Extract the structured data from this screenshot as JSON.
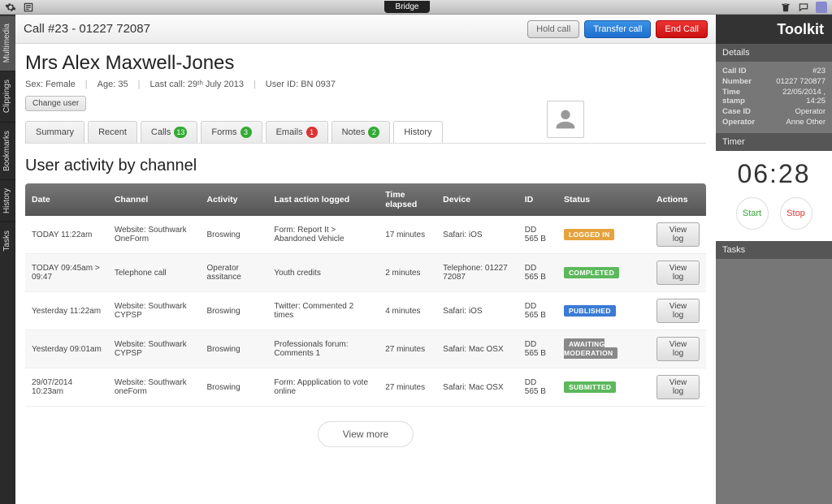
{
  "osbar": {
    "center_label": "Bridge"
  },
  "callbar": {
    "title": "Call #23 - 01227 72087",
    "hold": "Hold call",
    "transfer": "Transfer call",
    "end": "End Call"
  },
  "user": {
    "name": "Mrs Alex Maxwell-Jones",
    "sex_label": "Sex:",
    "sex": "Female",
    "age_label": "Age:",
    "age": "35",
    "last_call_label": "Last call:",
    "last_call": "29ᵗʰ July  2013",
    "user_id_label": "User ID:",
    "user_id": "BN 0937",
    "change": "Change user"
  },
  "tabs": {
    "summary": "Summary",
    "recent": "Recent",
    "calls": "Calls",
    "calls_badge": "13",
    "forms": "Forms",
    "forms_badge": "3",
    "emails": "Emails",
    "emails_badge": "1",
    "notes": "Notes",
    "notes_badge": "2",
    "history": "History"
  },
  "section_title": "User activity by channel",
  "headers": {
    "date": "Date",
    "channel": "Channel",
    "activity": "Activity",
    "last": "Last action logged",
    "elapsed": "Time elapsed",
    "device": "Device",
    "id": "ID",
    "status": "Status",
    "actions": "Actions"
  },
  "view_log": "View log",
  "view_more": "View more",
  "rows": [
    {
      "date": "TODAY 11:22am",
      "channel": "Website: Southwark OneForm",
      "activity": "Broswing",
      "last": "Form: Report It > Abandoned Vehicle",
      "elapsed": "17 minutes",
      "device": "Safari: iOS",
      "id": "DD 565 B",
      "status": "LOGGED IN",
      "st": "st-logged"
    },
    {
      "date": "TODAY 09:45am > 09:47",
      "channel": "Telephone call",
      "activity": "Operator assitance",
      "last": "Youth credits",
      "elapsed": "2 minutes",
      "device": "Telephone: 01227 72087",
      "id": "DD 565 B",
      "status": "COMPLETED",
      "st": "st-completed"
    },
    {
      "date": "Yesterday 11:22am",
      "channel": "Website: Southwark CYPSP",
      "activity": "Broswing",
      "last": "Twitter: Commented 2 times",
      "elapsed": "4 minutes",
      "device": "Safari: iOS",
      "id": "DD 565 B",
      "status": "PUBLISHED",
      "st": "st-published"
    },
    {
      "date": "Yesterday 09:01am",
      "channel": "Website: Southwark CYPSP",
      "activity": "Broswing",
      "last": "Professionals forum: Comments 1",
      "elapsed": "27 minutes",
      "device": "Safari: Mac OSX",
      "id": "DD 565 B",
      "status": "AWAITING MODERATION",
      "st": "st-moderation"
    },
    {
      "date": "29/07/2014 10:23am",
      "channel": "Website: Southwark oneForm",
      "activity": "Broswing",
      "last": "Form: Appplication to vote online",
      "elapsed": "27 minutes",
      "device": "Safari: Mac OSX",
      "id": "DD 565 B",
      "status": "SUBMITTED",
      "st": "st-submitted"
    }
  ],
  "toolkit": {
    "brand": "Toolkit",
    "details_head": "Details",
    "details": [
      {
        "k": "Call ID",
        "v": "#23"
      },
      {
        "k": "Number",
        "v": "01227 720877"
      },
      {
        "k": "Time stamp",
        "v": "22/05/2014 , 14:25"
      },
      {
        "k": "Case ID",
        "v": "Operator"
      },
      {
        "k": "Operator",
        "v": "Anne Other"
      }
    ],
    "timer_head": "Timer",
    "timer": "06:28",
    "start": "Start",
    "stop": "Stop",
    "tasks_head": "Tasks"
  },
  "vtabs": [
    "Multimedia",
    "Clippings",
    "Bookmarks",
    "History",
    "Tasks"
  ]
}
